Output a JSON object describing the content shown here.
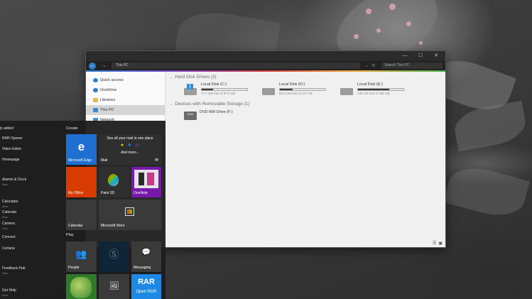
{
  "explorer": {
    "address": "This PC",
    "search_placeholder": "Search This PC",
    "nav": [
      {
        "label": "Quick access"
      },
      {
        "label": "OneDrive"
      },
      {
        "label": "Libraries"
      },
      {
        "label": "This PC"
      },
      {
        "label": "Network"
      }
    ],
    "hard_drives_header": "Hard Disk Drives (3)",
    "removable_header": "Devices with Removable Storage (1)",
    "drives": [
      {
        "name": "Local Disk (C:)",
        "free": "72.7 GB free of 97.6 GB",
        "used_fraction": 0.255
      },
      {
        "name": "Local Disk (D:)",
        "free": "85.0 GB free of 117 GB",
        "used_fraction": 0.274
      },
      {
        "name": "Local Disk (E:)",
        "free": "149 GB free of 482 GB",
        "used_fraction": 0.691
      }
    ],
    "dvd": {
      "name": "DVD RW Drive (F:)",
      "icon_text": "DVD"
    }
  },
  "start": {
    "recently_added": "ly added",
    "apps": [
      {
        "label": "RAR Opener",
        "sub": ""
      },
      {
        "label": "Video Editor",
        "sub": ""
      },
      {
        "label": "Homepage",
        "sub": ""
      },
      {
        "label": "Alarms & Clock",
        "sub": "New"
      },
      {
        "label": "Calculator",
        "sub": "New"
      },
      {
        "label": "Calendar",
        "sub": "New"
      },
      {
        "label": "Camera",
        "sub": "New"
      },
      {
        "label": "Connect",
        "sub": ""
      },
      {
        "label": "Cortana",
        "sub": ""
      },
      {
        "label": "Feedback Hub",
        "sub": "New"
      },
      {
        "label": "Get Help",
        "sub": "New"
      }
    ],
    "create_title": "Create",
    "play_title": "Play",
    "mail_tile": {
      "headline": "See all your mail in one place",
      "more": "And more...",
      "label": "Mail"
    },
    "tiles": [
      {
        "label": "Microsoft Edge",
        "icon": "e"
      },
      {
        "label": "My Office"
      },
      {
        "label": "Paint 3D"
      },
      {
        "label": "OneNote"
      },
      {
        "label": "Calendar"
      },
      {
        "label": "Microsoft Store"
      },
      {
        "label": "People"
      },
      {
        "label": ""
      },
      {
        "label": "Messaging"
      },
      {
        "label": ""
      },
      {
        "label": ""
      },
      {
        "label": "Open RAR",
        "icon": "RAR"
      }
    ]
  },
  "colors": {
    "accent": "#2d7fd0",
    "office": "#d83b01",
    "onenote": "#7719aa",
    "rar": "#1e88e5"
  }
}
